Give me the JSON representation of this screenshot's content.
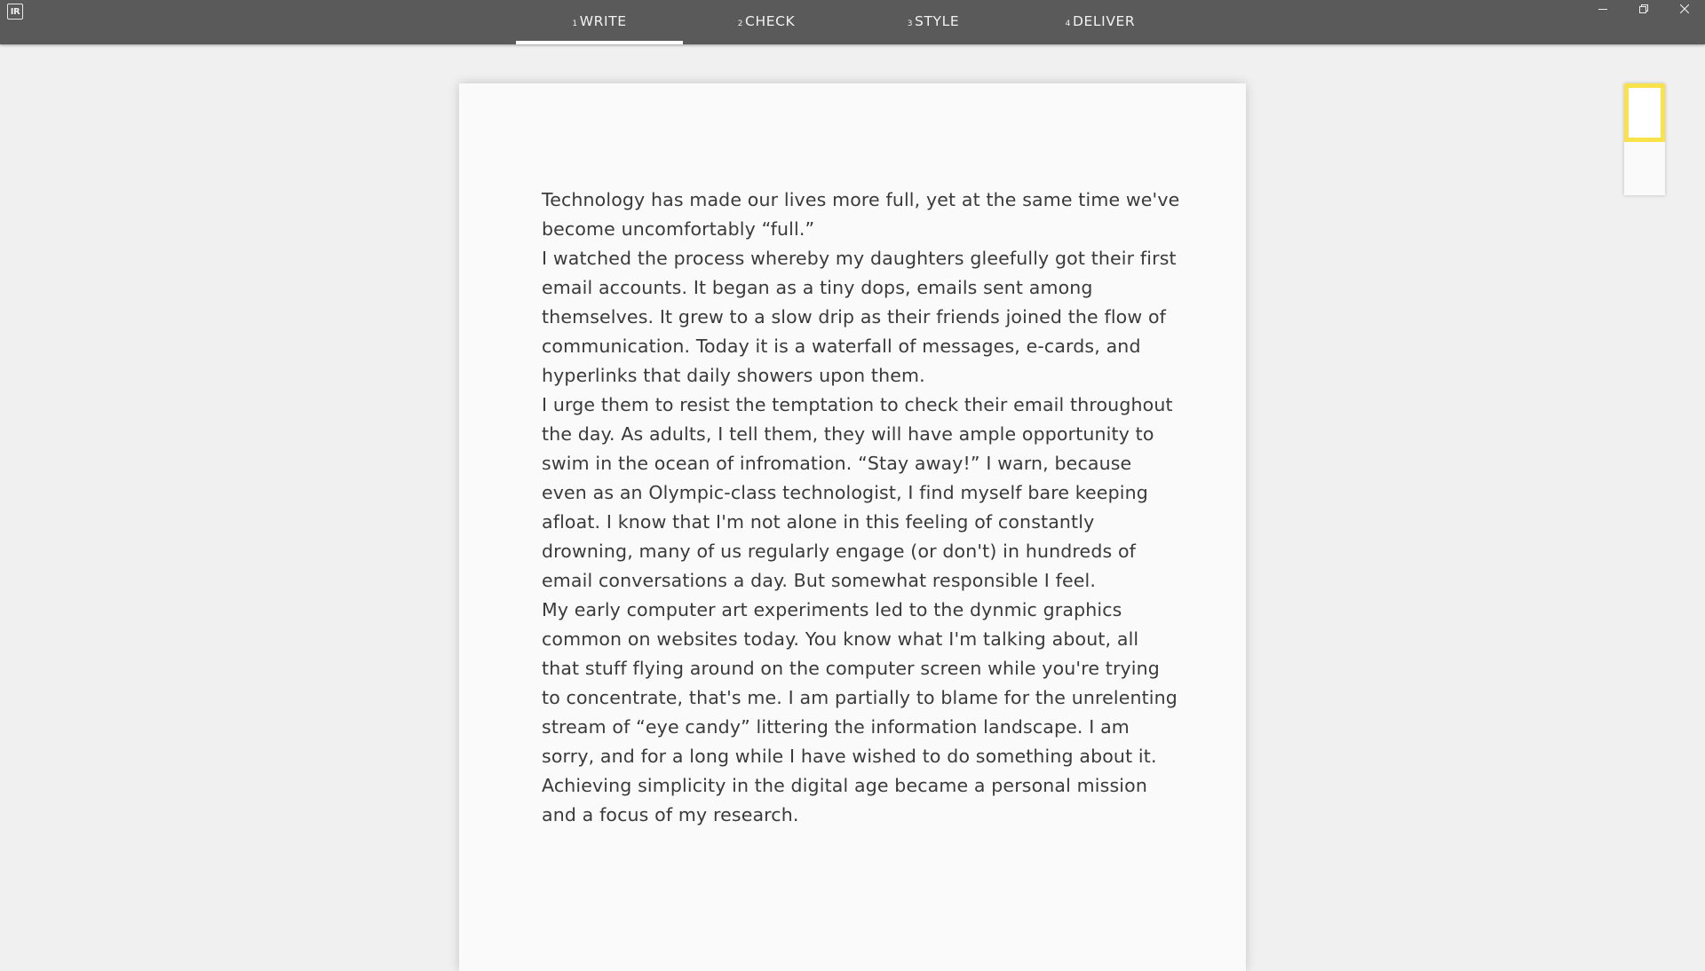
{
  "app": {
    "logo_text": "IR",
    "tabs": [
      {
        "num": "1",
        "label": "WRITE",
        "active": true
      },
      {
        "num": "2",
        "label": "CHECK",
        "active": false
      },
      {
        "num": "3",
        "label": "STYLE",
        "active": false
      },
      {
        "num": "4",
        "label": "DELIVER",
        "active": false
      }
    ]
  },
  "document": {
    "paragraphs": [
      "Technology has made our lives more full, yet at the same time we've become uncomfortably “full.”",
      "I watched the process whereby my daughters gleefully got their first email accounts. It began as a tiny dops, emails sent among themselves. It grew to a slow drip as their friends joined the flow of communication. Today it is a waterfall of messages, e-cards, and hyperlinks that daily showers upon them.",
      "I urge them to resist the temptation to check their email throughout the day. As adults, I tell them, they will have ample opportunity to swim in the ocean of infromation. “Stay away!” I warn, because even as an Olympic-class technologist, I find myself bare keeping afloat. I know that I'm not alone in this feeling of constantly drowning, many of us regularly engage (or don't) in hundreds of email conversations a day. But somewhat responsible I feel.",
      "My early computer art experiments led to the dynmic graphics common on websites today. You know what I'm talking about, all that stuff flying around on the computer screen while you're trying to concentrate, that's me. I am partially to blame for the unrelenting stream of “eye candy” littering the information landscape. I am sorry, and for a long while I have wished to do something about it. Achieving simplicity in the digital age became a personal mission and a focus of my research."
    ]
  },
  "colors": {
    "titlebar": "#5a5a5a",
    "background": "#f0f0f0",
    "page": "#fafafa",
    "viewport_highlight": "#f9e24a"
  },
  "icons": [
    "app-logo-icon",
    "minimize-icon",
    "restore-icon",
    "close-icon"
  ]
}
